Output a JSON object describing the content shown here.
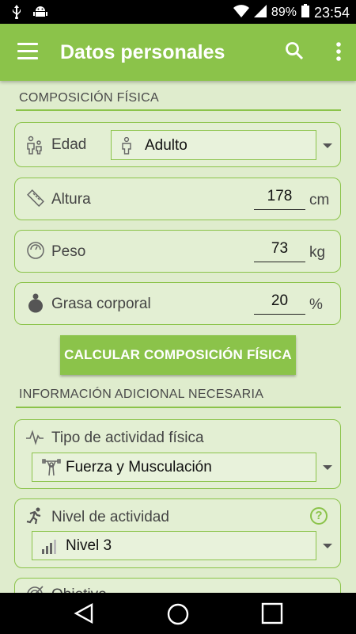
{
  "status": {
    "battery": "89%",
    "time": "23:54"
  },
  "appbar": {
    "title": "Datos personales"
  },
  "section1": {
    "title": "COMPOSICIÓN FÍSICA",
    "edad": {
      "label": "Edad",
      "value": "Adulto"
    },
    "altura": {
      "label": "Altura",
      "value": "178",
      "unit": "cm"
    },
    "peso": {
      "label": "Peso",
      "value": "73",
      "unit": "kg"
    },
    "grasa": {
      "label": "Grasa corporal",
      "value": "20",
      "unit": "%"
    },
    "button": "CALCULAR COMPOSICIÓN FÍSICA"
  },
  "section2": {
    "title": "INFORMACIÓN ADICIONAL NECESARIA",
    "tipo": {
      "label": "Tipo de actividad física",
      "value": "Fuerza y Musculación"
    },
    "nivel": {
      "label": "Nivel de actividad",
      "value": "Nivel 3",
      "help": "?"
    },
    "objetivo": {
      "label": "Objetivo"
    }
  },
  "colors": {
    "accent": "#8bc34a",
    "background": "#dfeccd"
  },
  "icons": [
    "usb-icon",
    "android-icon",
    "wifi-icon",
    "signal-icon",
    "battery-icon",
    "menu-icon",
    "search-icon",
    "more-icon",
    "family-icon",
    "person-icon",
    "ruler-icon",
    "scale-icon",
    "body-fat-icon",
    "pulse-icon",
    "weightlifter-icon",
    "runner-icon",
    "signal-bars-icon",
    "help-icon",
    "target-icon",
    "back-icon",
    "home-icon",
    "recents-icon"
  ]
}
